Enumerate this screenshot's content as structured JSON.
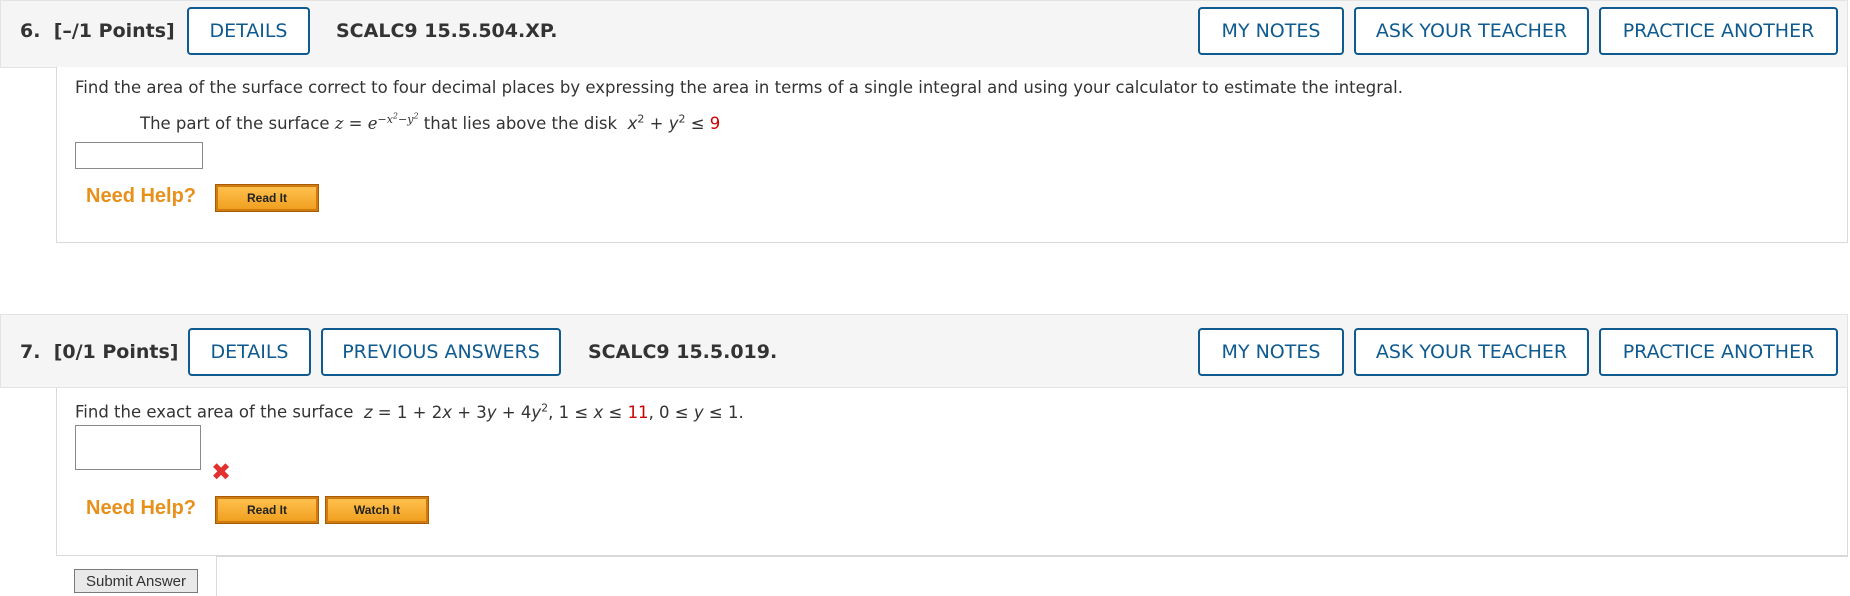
{
  "q6": {
    "number": "6.",
    "points": "[–/1 Points]",
    "details_label": "DETAILS",
    "code": "SCALC9 15.5.504.XP.",
    "my_notes_label": "MY NOTES",
    "ask_teacher_label": "ASK YOUR TEACHER",
    "practice_label": "PRACTICE ANOTHER",
    "prompt": "Find the area of the surface correct to four decimal places by expressing the area in terms of a single integral and using your calculator to estimate the integral.",
    "sub_prompt_a": "The part of the surface",
    "sub_prompt_b": "that lies above the disk",
    "disk_value": "9",
    "answer_value": "",
    "need_help_label": "Need Help?",
    "read_it_label": "Read It"
  },
  "q7": {
    "number": "7.",
    "points": "[0/1 Points]",
    "details_label": "DETAILS",
    "previous_answers_label": "PREVIOUS ANSWERS",
    "code": "SCALC9 15.5.019.",
    "my_notes_label": "MY NOTES",
    "ask_teacher_label": "ASK YOUR TEACHER",
    "practice_label": "PRACTICE ANOTHER",
    "prompt_a": "Find the exact area of the surface",
    "x_upper": "11",
    "answer_value": "",
    "need_help_label": "Need Help?",
    "read_it_label": "Read It",
    "watch_it_label": "Watch It",
    "submit_label": "Submit Answer"
  },
  "colors": {
    "accent_blue": "#0f5a8f",
    "need_help_orange": "#e8901a",
    "wrong_red": "#e03030",
    "value_red": "#cc0000"
  },
  "icons": {
    "incorrect": "x-mark-icon"
  }
}
